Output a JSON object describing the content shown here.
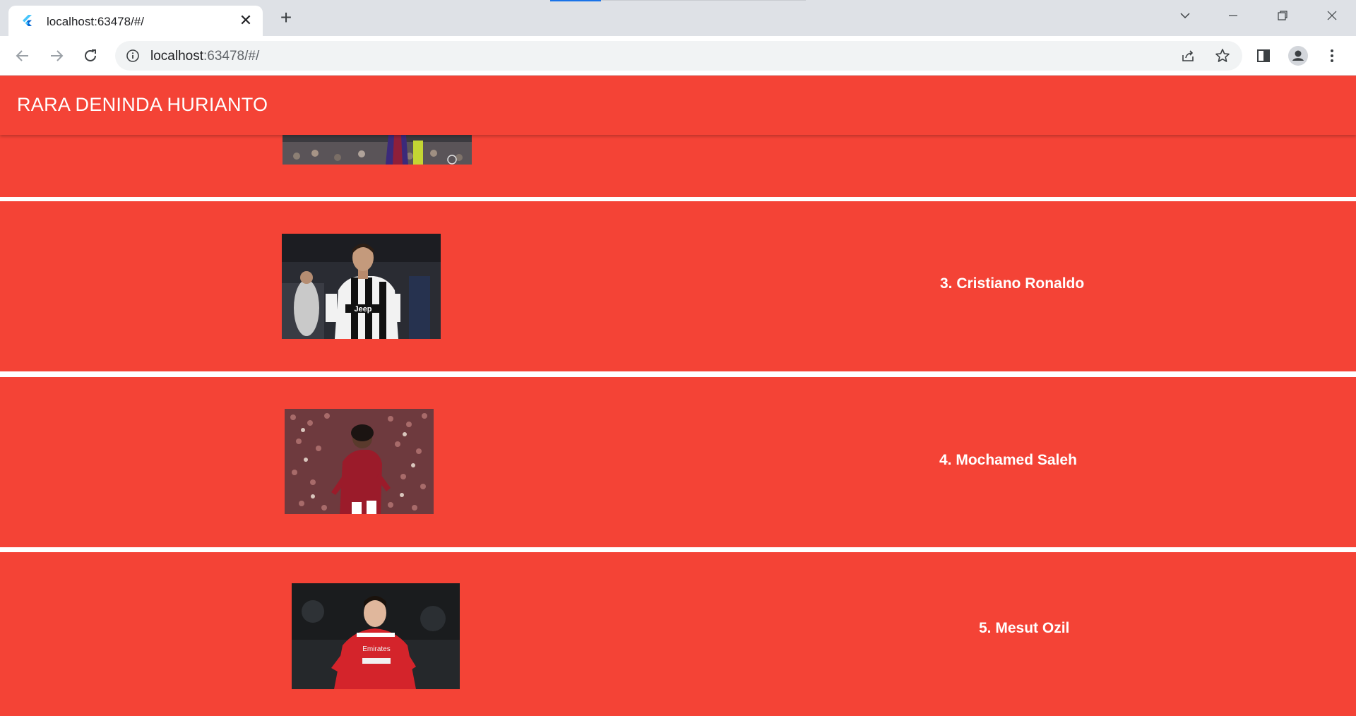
{
  "browser": {
    "tab_title": "localhost:63478/#/",
    "url_host": "localhost",
    "url_rest": ":63478/#/"
  },
  "app": {
    "title": "RARA DENINDA HURIANTO",
    "players": [
      {
        "name": ""
      },
      {
        "name": "3. Cristiano Ronaldo"
      },
      {
        "name": "4. Mochamed Saleh"
      },
      {
        "name": "5. Mesut Ozil"
      }
    ]
  },
  "colors": {
    "primary": "#f44336",
    "divider": "#ffffff"
  }
}
